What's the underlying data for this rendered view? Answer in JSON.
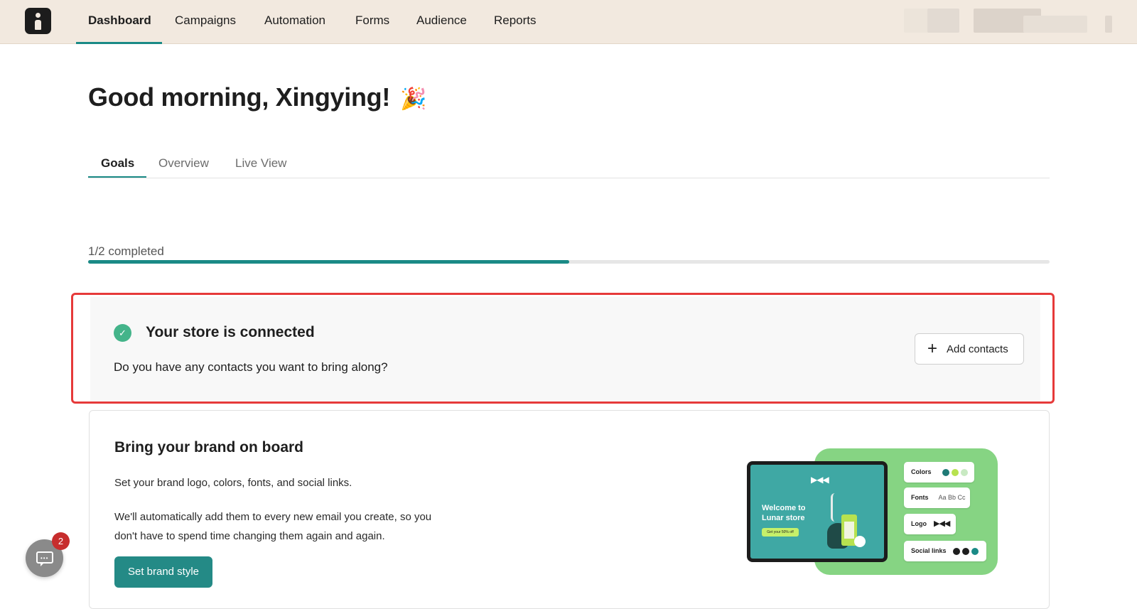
{
  "nav": {
    "items": [
      {
        "label": "Dashboard",
        "active": true
      },
      {
        "label": "Campaigns",
        "active": false
      },
      {
        "label": "Automation",
        "active": false
      },
      {
        "label": "Forms",
        "active": false
      },
      {
        "label": "Audience",
        "active": false
      },
      {
        "label": "Reports",
        "active": false
      }
    ]
  },
  "greeting": {
    "text": "Good morning, Xingying!",
    "emoji": "🎉"
  },
  "tabs": [
    {
      "label": "Goals",
      "active": true
    },
    {
      "label": "Overview",
      "active": false
    },
    {
      "label": "Live View",
      "active": false
    }
  ],
  "progress": {
    "label": "1/2 completed",
    "completed": 1,
    "total": 2,
    "fraction": 0.5
  },
  "store_card": {
    "title": "Your store is connected",
    "question": "Do you have any contacts you want to bring along?",
    "add_contacts_label": "Add contacts",
    "status": "completed"
  },
  "brand_card": {
    "title": "Bring your brand on board",
    "paragraph1": "Set your brand logo, colors, fonts, and social links.",
    "paragraph2": "We'll automatically add them to every new email you create, so you don't have to spend time changing them again and again.",
    "button_label": "Set brand style"
  },
  "illustration": {
    "screen_title": "Welcome to Lunar store",
    "screen_button": "Get your 50% off",
    "chips": {
      "colors": "Colors",
      "fonts": "Fonts",
      "fonts_sample": "Aa Bb Cc",
      "logo": "Logo",
      "social": "Social links"
    },
    "swatch_colors": [
      "#1f7a76",
      "#b7e24f",
      "#c8e9c2"
    ]
  },
  "chat": {
    "badge_count": "2"
  },
  "colors": {
    "accent": "#1a8a86",
    "highlight_border": "#e63a3a",
    "nav_bg": "#f2e9df",
    "check": "#44b48a",
    "badge": "#c72d2d"
  }
}
